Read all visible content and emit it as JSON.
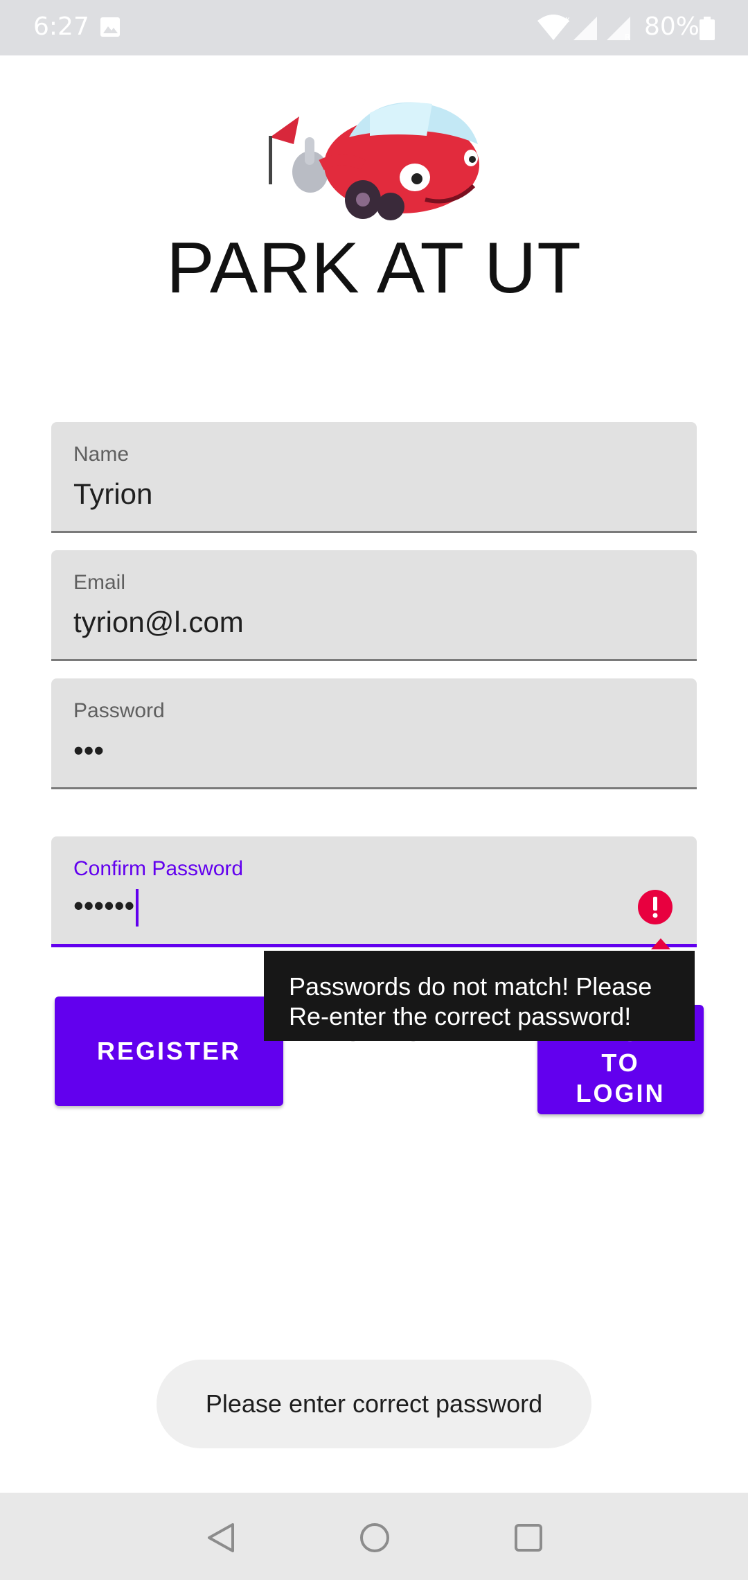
{
  "status_bar": {
    "time": "6:27",
    "battery": "80%",
    "icons": [
      "image-icon",
      "wifi-icon",
      "signal-icon",
      "signal-icon",
      "battery-icon"
    ]
  },
  "app": {
    "title": "PARK AT UT",
    "logo": "car-mascot-logo"
  },
  "form": {
    "name": {
      "label": "Name",
      "value": "Tyrion"
    },
    "email": {
      "label": "Email",
      "value": "tyrion@l.com"
    },
    "password": {
      "label": "Password",
      "value": "•••"
    },
    "confirm_password": {
      "label": "Confirm Password",
      "value": "••••••"
    }
  },
  "error_popup": {
    "line1": "Passwords do not match! Please",
    "line2": "Re-enter the correct password!"
  },
  "buttons": {
    "register": "REGISTER",
    "cancel": "CANCEL",
    "back_line1": "BACK",
    "back_line2": "TO",
    "back_line3": "LOGIN"
  },
  "toast": "Please enter correct password",
  "colors": {
    "accent": "#6200ee",
    "error": "#e8003f",
    "field_bg": "#e1e1e1"
  }
}
